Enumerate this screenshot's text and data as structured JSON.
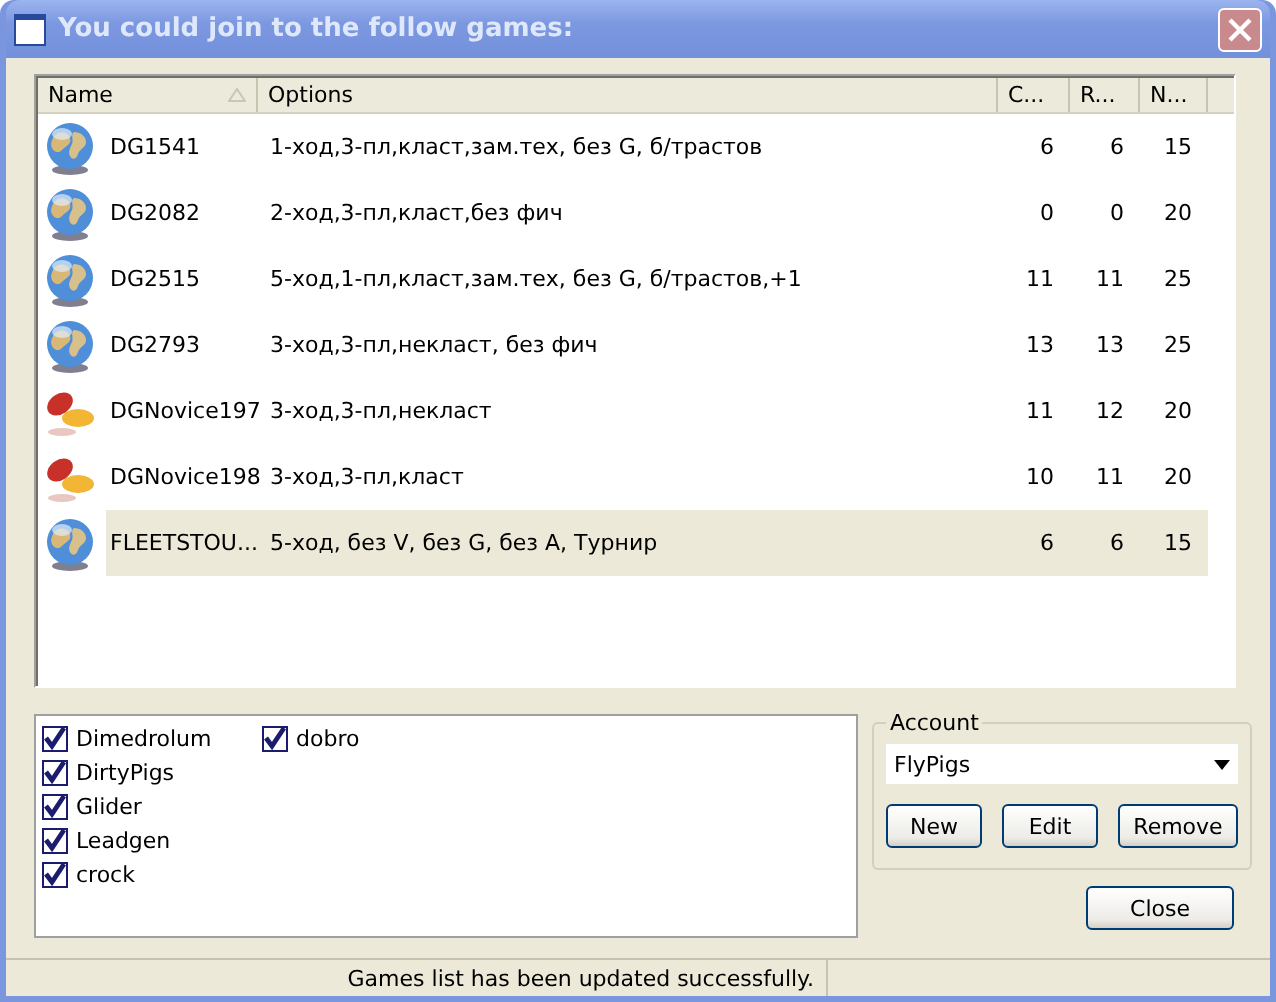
{
  "window": {
    "title": "You could join to the follow games:"
  },
  "table": {
    "columns": [
      {
        "label": "Name",
        "sorted": true
      },
      {
        "label": "Options",
        "sorted": false
      },
      {
        "label": "C...",
        "sorted": false
      },
      {
        "label": "R...",
        "sorted": false
      },
      {
        "label": "N...",
        "sorted": false
      }
    ],
    "rows": [
      {
        "kind": "globe",
        "name": "DG1541",
        "options": "1-ход,3-пл,класт,зам.тех, без G, б/трастов",
        "c": "6",
        "r": "6",
        "n": "15",
        "selected": false
      },
      {
        "kind": "globe",
        "name": "DG2082",
        "options": "2-ход,3-пл,класт,без фич",
        "c": "0",
        "r": "0",
        "n": "20",
        "selected": false
      },
      {
        "kind": "globe",
        "name": "DG2515",
        "options": "5-ход,1-пл,класт,зам.тех, без G, б/трастов,+1",
        "c": "11",
        "r": "11",
        "n": "25",
        "selected": false
      },
      {
        "kind": "globe",
        "name": "DG2793",
        "options": "3-ход,3-пл,некласт, без фич",
        "c": "13",
        "r": "13",
        "n": "25",
        "selected": false
      },
      {
        "kind": "pill",
        "name": "DGNovice197",
        "options": "3-ход,3-пл,некласт",
        "c": "11",
        "r": "12",
        "n": "20",
        "selected": false
      },
      {
        "kind": "pill",
        "name": "DGNovice198",
        "options": "3-ход,3-пл,класт",
        "c": "10",
        "r": "11",
        "n": "20",
        "selected": false
      },
      {
        "kind": "globe",
        "name": "FLEETSTOU...",
        "options": "5-ход, без V, без G, без A, Турнир",
        "c": "6",
        "r": "6",
        "n": "15",
        "selected": true
      }
    ]
  },
  "players": [
    {
      "label": "Dimedrolum",
      "checked": true
    },
    {
      "label": "DirtyPigs",
      "checked": true
    },
    {
      "label": "Glider",
      "checked": true
    },
    {
      "label": "Leadgen",
      "checked": true
    },
    {
      "label": "crock",
      "checked": true
    },
    {
      "label": "dobro",
      "checked": true
    }
  ],
  "account": {
    "legend": "Account",
    "value": "FlyPigs",
    "buttons": [
      "New",
      "Edit",
      "Remove"
    ]
  },
  "close_button": "Close",
  "status_bar": "Games list has been updated successfully."
}
